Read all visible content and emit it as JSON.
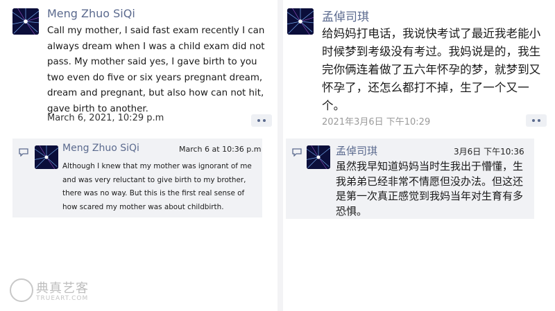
{
  "left": {
    "post": {
      "author": "Meng Zhuo SiQi",
      "avatar_icon": "starburst-avatar-icon",
      "text": "Call my mother, I said fast exam recently I can always dream when I was a child exam did not pass. My mother said yes, I gave birth to you two even do five or six years pregnant dream, dream and pregnant, but also how can not hit, gave birth to another.",
      "timestamp": "March 6, 2021, 10:29 p.m"
    },
    "reply": {
      "author": "Meng Zhuo SiQi",
      "timestamp": "March 6 at 10:36 p.m",
      "text": "Although I knew that my mother was ignorant of me and was very reluctant to give birth to my brother, there was no way. But this is the first real sense of how scared my mother was about childbirth."
    }
  },
  "right": {
    "post": {
      "author": "孟倬司琪",
      "avatar_icon": "starburst-avatar-icon",
      "text": "给妈妈打电话，我说快考试了最近我老能小时候梦到考级没有考过。我妈说是的，我生完你俩连着做了五六年怀孕的梦，就梦到又怀孕了，还怎么都打不掉，生了一个又一个。",
      "timestamp": "2021年3月6日 下午10:29"
    },
    "reply": {
      "author": "孟倬司琪",
      "timestamp": "3月6日 下午10:36",
      "text": "虽然我早知道妈妈当时生我出于懵懂，生我弟弟已经非常不情愿但没办法。但这还是第一次真正感觉到我妈当年对生育有多恐惧。"
    }
  },
  "watermark": {
    "title": "典真艺客",
    "subtitle": "TRUEART.COM"
  },
  "colors": {
    "name": "#5b6a8e",
    "panel": "#ffffff",
    "reply_bg": "#f1f2f5",
    "page_bg": "#f3f3f5"
  }
}
